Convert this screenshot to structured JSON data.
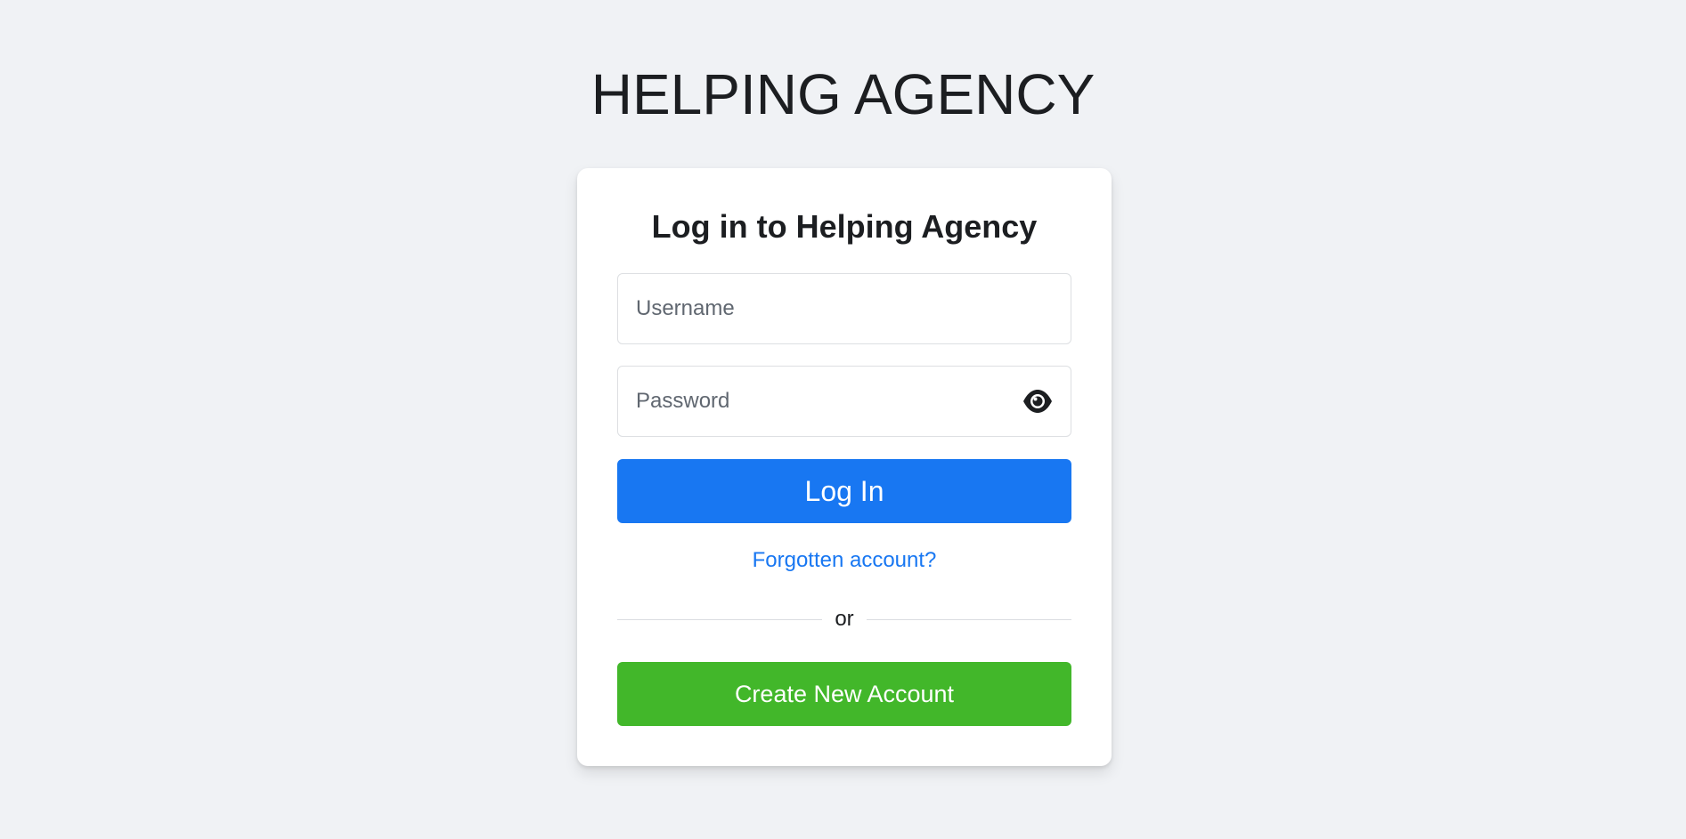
{
  "brand": {
    "title": "HELPING AGENCY"
  },
  "login_card": {
    "title": "Log in to Helping Agency",
    "username": {
      "placeholder": "Username",
      "value": ""
    },
    "password": {
      "placeholder": "Password",
      "value": "",
      "toggle_icon": "eye-icon"
    },
    "login_button": "Log In",
    "forgot_link": "Forgotten account?",
    "divider_text": "or",
    "create_button": "Create New Account"
  },
  "colors": {
    "background": "#f0f2f5",
    "primary": "#1877f2",
    "success": "#42b72a",
    "text": "#1c1e21"
  }
}
